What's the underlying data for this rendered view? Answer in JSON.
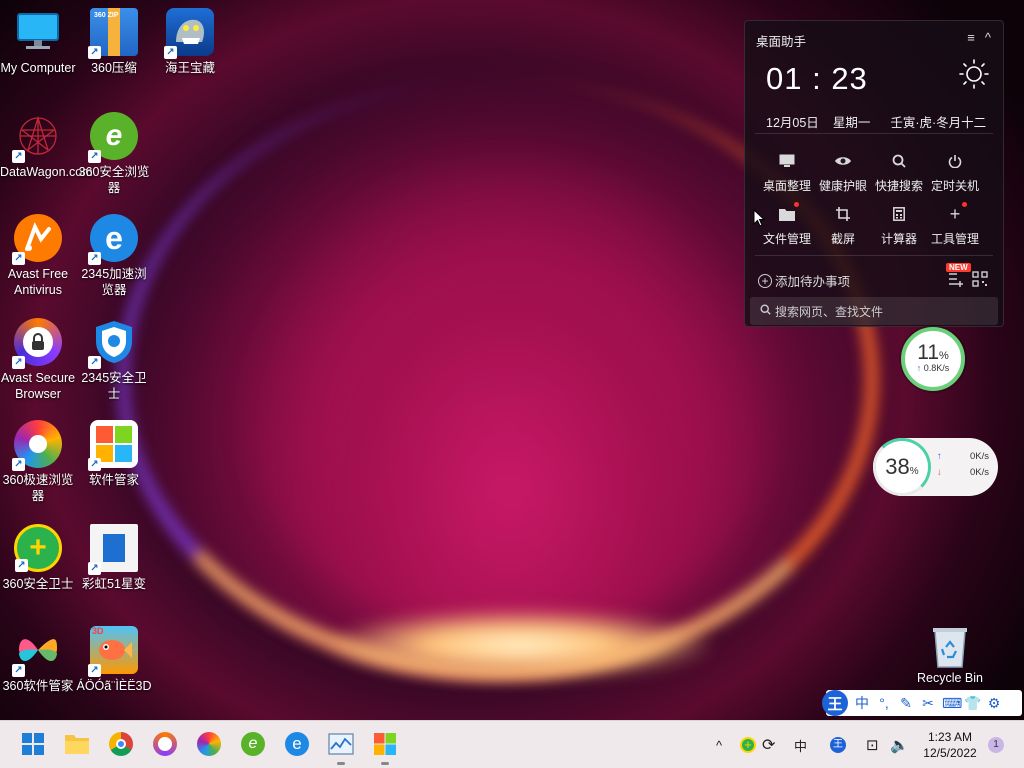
{
  "desktop": {
    "icons": [
      {
        "label": "My Computer"
      },
      {
        "label": "360压缩"
      },
      {
        "label": "海王宝藏"
      },
      {
        "label": "DataWagon.com"
      },
      {
        "label": "360安全浏览器"
      },
      {
        "label": "Avast Free Antivirus"
      },
      {
        "label": "2345加速浏览器"
      },
      {
        "label": "Avast Secure Browser"
      },
      {
        "label": "2345安全卫士"
      },
      {
        "label": "360极速浏览器"
      },
      {
        "label": "软件管家"
      },
      {
        "label": "360安全卫士"
      },
      {
        "label": "彩虹51星变"
      },
      {
        "label": "360软件管家"
      },
      {
        "label": "ÁÖÓã¨ÌÈË3D"
      }
    ],
    "recycle_bin": "Recycle Bin"
  },
  "widget": {
    "title": "桌面助手",
    "time": "01 : 23",
    "date": "12月05日",
    "weekday": "星期一",
    "lunar": "壬寅·虎·冬月十二",
    "tools": [
      {
        "label": "桌面整理",
        "icon": "monitor-icon"
      },
      {
        "label": "健康护眼",
        "icon": "eye-icon"
      },
      {
        "label": "快捷搜索",
        "icon": "search-icon"
      },
      {
        "label": "定时关机",
        "icon": "power-icon"
      },
      {
        "label": "文件管理",
        "icon": "folder-icon"
      },
      {
        "label": "截屏",
        "icon": "crop-icon"
      },
      {
        "label": "计算器",
        "icon": "calculator-icon"
      },
      {
        "label": "工具管理",
        "icon": "plus-icon"
      }
    ],
    "todo_label": "添加待办事项",
    "new_badge": "NEW",
    "search_placeholder": "搜索网页、查找文件"
  },
  "monitors": {
    "ball1_pct": "11",
    "ball1_unit": "%",
    "ball1_speed": "0.8K/s",
    "ball2_pct": "38",
    "ball2_unit": "%",
    "ball2_up": "0K/s",
    "ball2_down": "0K/s"
  },
  "ime": {
    "brand": "王",
    "mode": "中"
  },
  "taskbar": {
    "apps": [
      "start",
      "file-explorer",
      "chrome",
      "avast-secure-browser",
      "360-speed-browser",
      "360-safe-browser",
      "2345-browser",
      "task-manager",
      "software-manager"
    ],
    "tray_lang": "中",
    "time": "1:23 AM",
    "date": "12/5/2022",
    "notification_count": "1"
  }
}
